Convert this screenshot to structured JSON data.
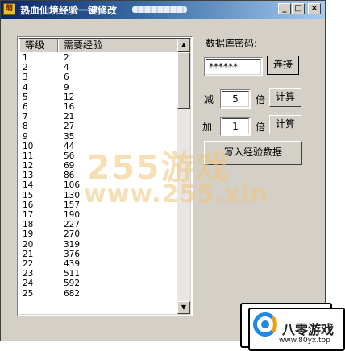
{
  "window": {
    "title": "热血仙境经验一键修改",
    "buttons": {
      "minimize": "_",
      "maximize": "□",
      "close": "×"
    }
  },
  "table": {
    "columns": [
      "等级",
      "需要经验"
    ],
    "rows": [
      {
        "level": "1",
        "xp": "2"
      },
      {
        "level": "2",
        "xp": "4"
      },
      {
        "level": "3",
        "xp": "6"
      },
      {
        "level": "4",
        "xp": "9"
      },
      {
        "level": "5",
        "xp": "12"
      },
      {
        "level": "6",
        "xp": "16"
      },
      {
        "level": "7",
        "xp": "21"
      },
      {
        "level": "8",
        "xp": "27"
      },
      {
        "level": "9",
        "xp": "35"
      },
      {
        "level": "10",
        "xp": "44"
      },
      {
        "level": "11",
        "xp": "56"
      },
      {
        "level": "12",
        "xp": "69"
      },
      {
        "level": "13",
        "xp": "86"
      },
      {
        "level": "14",
        "xp": "106"
      },
      {
        "level": "15",
        "xp": "130"
      },
      {
        "level": "16",
        "xp": "157"
      },
      {
        "level": "17",
        "xp": "190"
      },
      {
        "level": "18",
        "xp": "227"
      },
      {
        "level": "19",
        "xp": "270"
      },
      {
        "level": "20",
        "xp": "319"
      },
      {
        "level": "21",
        "xp": "376"
      },
      {
        "level": "22",
        "xp": "439"
      },
      {
        "level": "23",
        "xp": "511"
      },
      {
        "level": "24",
        "xp": "592"
      },
      {
        "level": "25",
        "xp": "682"
      }
    ],
    "scroll_up": "▲",
    "scroll_down": "▼"
  },
  "db": {
    "label": "数据库密码:",
    "password_value": "******",
    "connect_button": "连接"
  },
  "reduce": {
    "label": "减",
    "value": "5",
    "unit": "倍",
    "button": "计算"
  },
  "add": {
    "label": "加",
    "value": "1",
    "unit": "倍",
    "button": "计算"
  },
  "write_button": "写入经验数据",
  "watermark": {
    "line1": "255游戏",
    "line2": "www.255.xin"
  },
  "badge": {
    "name": "八零游戏",
    "url": "www.80yx.top"
  }
}
